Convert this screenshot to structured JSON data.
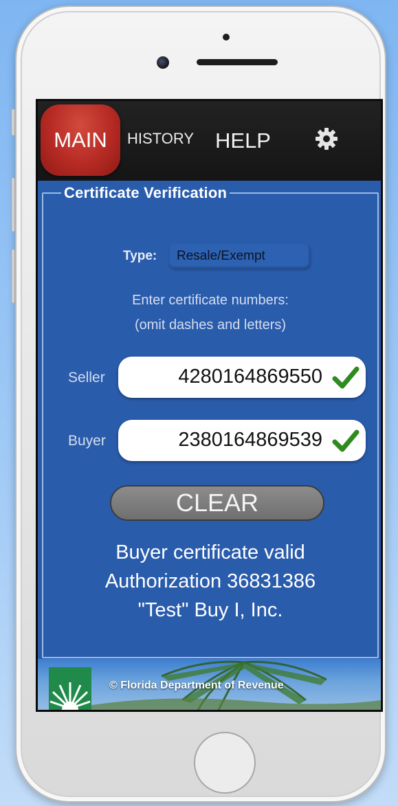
{
  "nav": {
    "main": "MAIN",
    "history": "HISTORY",
    "help": "HELP"
  },
  "section": {
    "legend": "Certificate Verification"
  },
  "type": {
    "label": "Type:",
    "value": "Resale/Exempt"
  },
  "instructions": {
    "line1": "Enter certificate numbers:",
    "line2": "(omit dashes and letters)"
  },
  "seller": {
    "label": "Seller",
    "value": "4280164869550"
  },
  "buyer": {
    "label": "Buyer",
    "value": "2380164869539"
  },
  "clear_label": "CLEAR",
  "result": {
    "line1": "Buyer certificate valid",
    "line2": "Authorization 36831386",
    "line3": "\"Test\" Buy I, Inc."
  },
  "footer": {
    "copyright": "© Florida Department of Revenue"
  },
  "icons": {
    "settings": "gear-icon",
    "valid": "checkmark-icon"
  },
  "colors": {
    "main_tab": "#b62a24",
    "panel": "#2a5cac",
    "check": "#2f8a1f"
  }
}
